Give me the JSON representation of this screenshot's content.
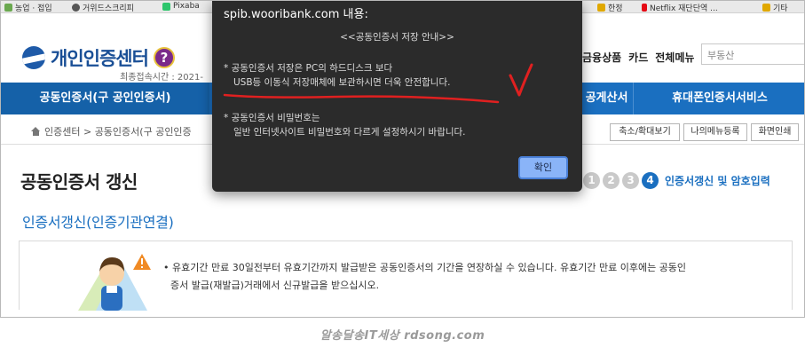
{
  "bookmarks": [
    {
      "label": "농업 · 접입",
      "color": "#6aa84f"
    },
    {
      "label": "거위드스크리피",
      "color": "#555555"
    },
    {
      "label": "Pixaba",
      "color": "#2ec66d"
    },
    {
      "label": "한정",
      "color": "#e0a800"
    },
    {
      "label": "Netflix 재단단역 ...",
      "color": "#e50914"
    },
    {
      "label": "기타",
      "color": "#e0a800"
    }
  ],
  "header": {
    "logo_text": "개인인증센터",
    "help_icon": "?",
    "last_access": "최종접속시간 : 2021-",
    "menu": [
      "금융상품",
      "카드",
      "전체메뉴"
    ],
    "search_placeholder": "부동산"
  },
  "nav": {
    "items": [
      "공동인증서(구 공인인증서)",
      "공게산서",
      "휴대폰인증서서비스"
    ]
  },
  "breadcrumb": {
    "text": "인증센터 > 공동인증서(구 공인인증"
  },
  "util_buttons": [
    "축소/확대보기",
    "나의메뉴등록",
    "화면인쇄"
  ],
  "main": {
    "title": "공동인증서 갱신",
    "steps": [
      "1",
      "2",
      "3",
      "4"
    ],
    "active_step_label": "인증서갱신 및 암호입력",
    "subtitle": "인증서갱신(인증기관연결)",
    "info_line1": "• 유효기간 만료 30일전부터 유효기간까지 발급받은 공동인증서의 기간을 연장하실 수 있습니다. 유효기간 만료 이후에는 공동인",
    "info_line2": "증서 발급(재발급)거래에서 신규발급을 받으십시오."
  },
  "dialog": {
    "title": "spib.wooribank.com 내용:",
    "subtitle": "<<공동인증서 저장 안내>>",
    "para1_line1": "* 공동인증서 저장은 PC의 하드디스크 보다",
    "para1_line2": "USB등 이동식 저장매체에 보관하시면 더욱 안전합니다.",
    "para2_line1": "* 공동인증서 비밀번호는",
    "para2_line2": "일반 인터넷사이트 비밀번호와 다르게 설정하시기 바랍니다.",
    "ok_label": "확인"
  },
  "watermark": "알송달송IT세상 rdsong.com",
  "colors": {
    "nav_blue": "#1a6fc0",
    "logo_blue": "#1a4f96",
    "dialog_bg": "#2b2b2b",
    "ok_button": "#8ab4f8",
    "annotation_red": "#e02020"
  }
}
